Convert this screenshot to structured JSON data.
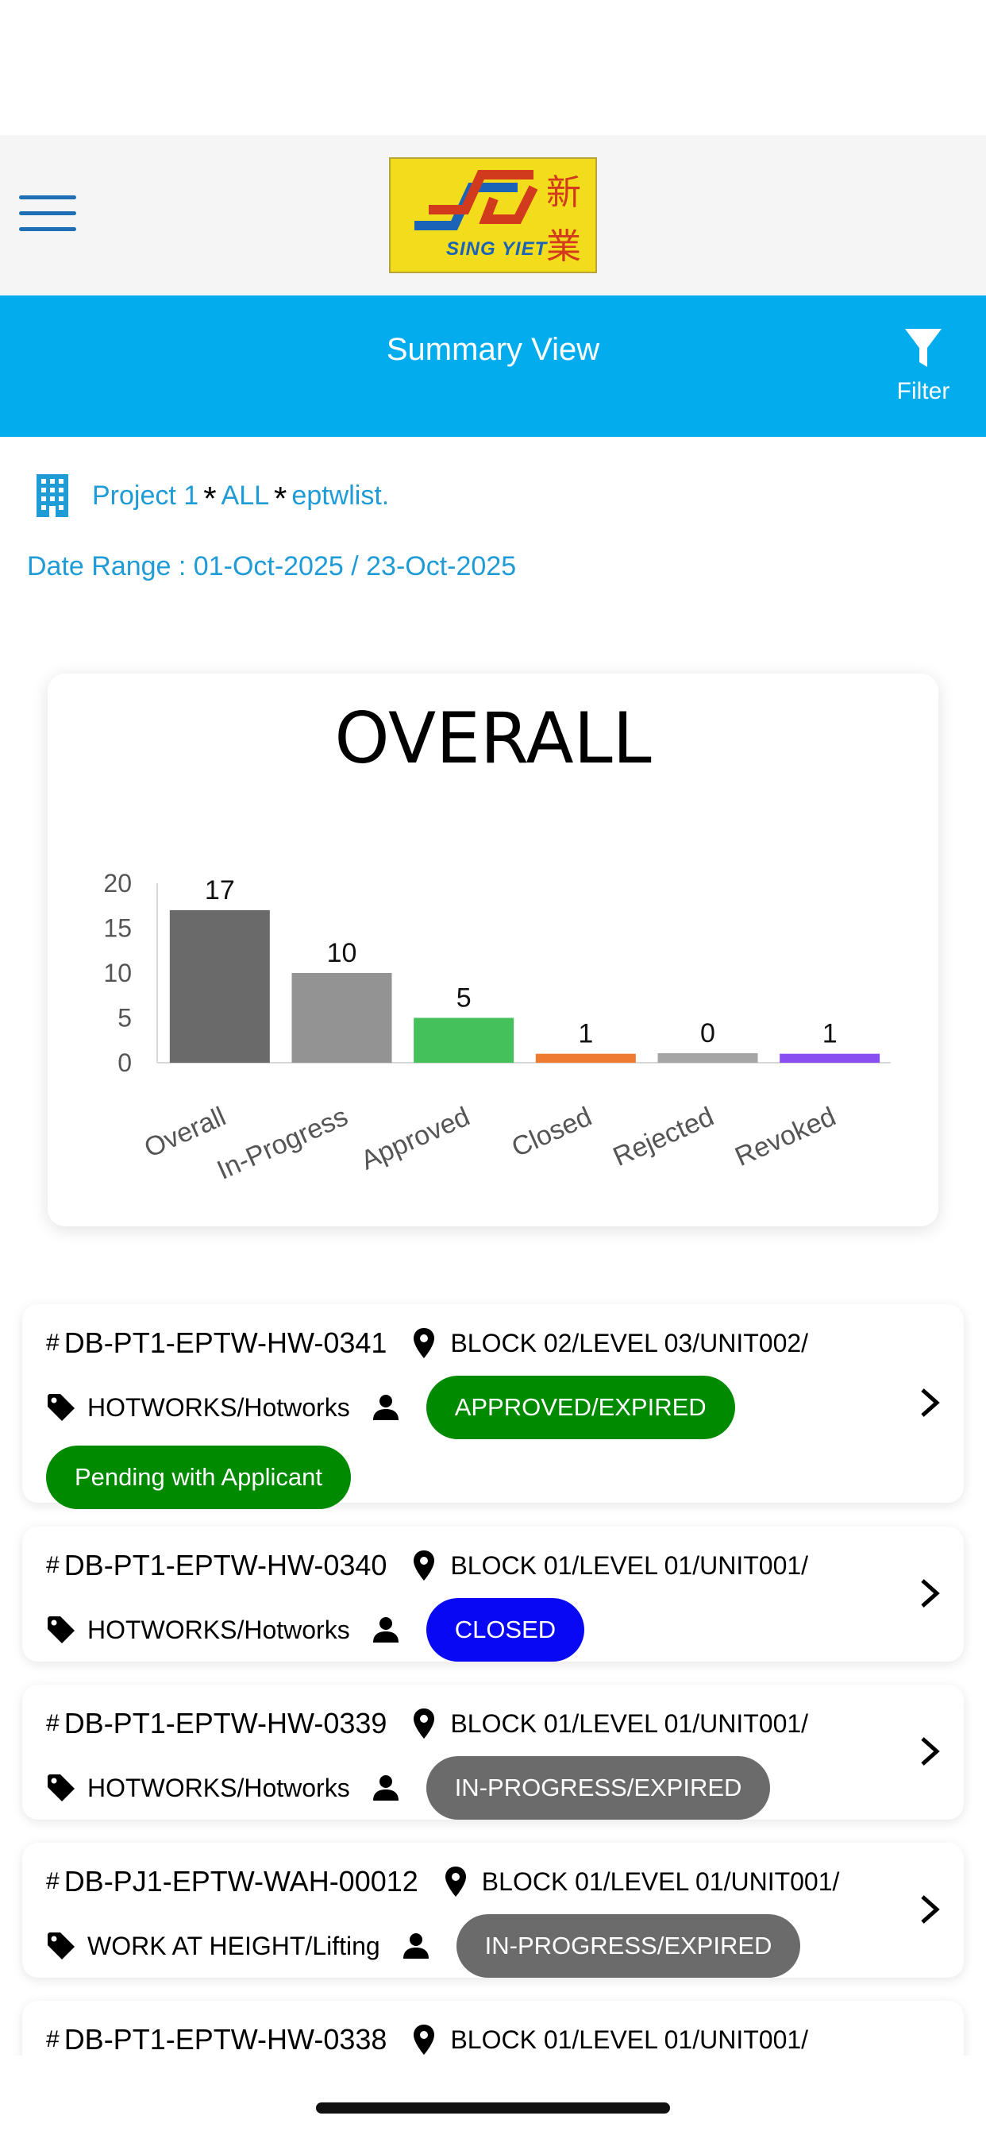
{
  "header": {
    "logo_en": "SING YIET",
    "logo_cn_1": "新",
    "logo_cn_2": "業"
  },
  "title_bar": {
    "title": "Summary View",
    "filter_label": "Filter"
  },
  "filter_summary": {
    "project": "Project 1",
    "separator": "*",
    "scope": "ALL",
    "list": "eptwlist.",
    "date_label": "Date Range : ",
    "date_from": "01-Oct-2025",
    "date_sep": " / ",
    "date_to": "23-Oct-2025"
  },
  "chart_data": {
    "type": "bar",
    "title": "OVERALL",
    "categories": [
      "Overall",
      "In-Progress",
      "Approved",
      "Closed",
      "Rejected",
      "Revoked"
    ],
    "values": [
      17,
      10,
      5,
      1,
      0,
      1
    ],
    "colors": [
      "#6a6a6a",
      "#939393",
      "#44c15a",
      "#ee7b30",
      "#a6a6a6",
      "#8a4ff0"
    ],
    "ylim": [
      0,
      20
    ],
    "yticks": [
      0,
      5,
      10,
      15,
      20
    ],
    "xlabel": "",
    "ylabel": "",
    "grid": false,
    "legend": "none"
  },
  "permits": [
    {
      "id": "DB-PT1-EPTW-HW-0341",
      "location": "BLOCK 02/LEVEL 03/UNIT002/",
      "type": "HOTWORKS/Hotworks",
      "status": "APPROVED/EXPIRED",
      "status_color": "green",
      "substatus": "Pending with Applicant"
    },
    {
      "id": "DB-PT1-EPTW-HW-0340",
      "location": "BLOCK 01/LEVEL 01/UNIT001/",
      "type": "HOTWORKS/Hotworks",
      "status": "CLOSED",
      "status_color": "blue"
    },
    {
      "id": "DB-PT1-EPTW-HW-0339",
      "location": "BLOCK 01/LEVEL 01/UNIT001/",
      "type": "HOTWORKS/Hotworks",
      "status": "IN-PROGRESS/EXPIRED",
      "status_color": "gray"
    },
    {
      "id": "DB-PJ1-EPTW-WAH-00012",
      "location": "BLOCK 01/LEVEL 01/UNIT001/",
      "type": "WORK AT HEIGHT/Lifting",
      "status": "IN-PROGRESS/EXPIRED",
      "status_color": "gray"
    },
    {
      "id": "DB-PT1-EPTW-HW-0338",
      "location": "BLOCK 01/LEVEL 01/UNIT001/"
    }
  ],
  "hash_symbol": "#",
  "icons": {
    "menu": "hamburger-menu-icon",
    "filter": "funnel-icon",
    "building": "building-icon",
    "location": "map-pin-icon",
    "tag": "tag-icon",
    "person": "person-icon",
    "chevron": "chevron-right-icon"
  }
}
